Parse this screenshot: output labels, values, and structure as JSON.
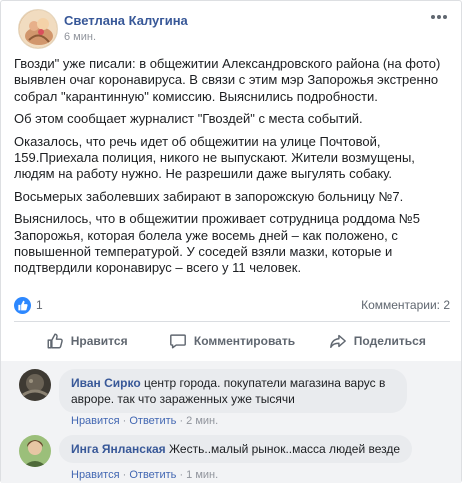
{
  "post": {
    "author": "Светлана Калугина",
    "time": "6 мин.",
    "paragraphs": [
      "Гвозди\" уже писали: в общежитии Александровского района (на фото) выявлен очаг коронавируса. В связи с этим мэр Запорожья экстренно собрал \"карантинную\" комиссию. Выяснились подробности.",
      "Об этом сообщает журналист \"Гвоздей\" с места событий.",
      "Оказалось, что речь идет об общежитии на улице Почтовой, 159.Приехала полиция, никого не выпускают. Жители возмущены, людям на работу нужно. Не разрешили даже выгулять собаку.",
      "Восьмерых заболевших забирают в запорожскую больницу №7.",
      "Выяснилось, что в общежитии проживает сотрудница роддома №5 Запорожья, которая болела уже восемь дней – как положено, с повышенной температурой. У соседей взяли мазки, которые и подтвердили коронавирус – всего у 11 человек."
    ]
  },
  "reactions": {
    "like_count": "1",
    "comments_count": "Комментарии: 2",
    "like_color": "#2d88ff"
  },
  "actions": {
    "like": "Нравится",
    "comment": "Комментировать",
    "share": "Поделиться"
  },
  "comments": [
    {
      "author": "Иван Сирко",
      "text": "центр города. покупатели магазина варус в авроре. так что зараженных уже тысячи",
      "like": "Нравится",
      "reply": "Ответить",
      "sep": "·",
      "time": "2 мин."
    },
    {
      "author": "Инга Янланская",
      "text": "Жесть..малый рынок..масса людей везде",
      "like": "Нравится",
      "reply": "Ответить",
      "sep": "·",
      "time": "1 мин."
    }
  ],
  "colors": {
    "link": "#385898",
    "meta": "#90949c",
    "accent": "#4267b2"
  },
  "icons": {
    "more": "more-horizontal-icon",
    "like_badge": "thumbs-up-icon",
    "like_action": "thumbs-up-outline-icon",
    "comment_action": "speech-bubble-icon",
    "share_action": "share-arrow-icon"
  }
}
